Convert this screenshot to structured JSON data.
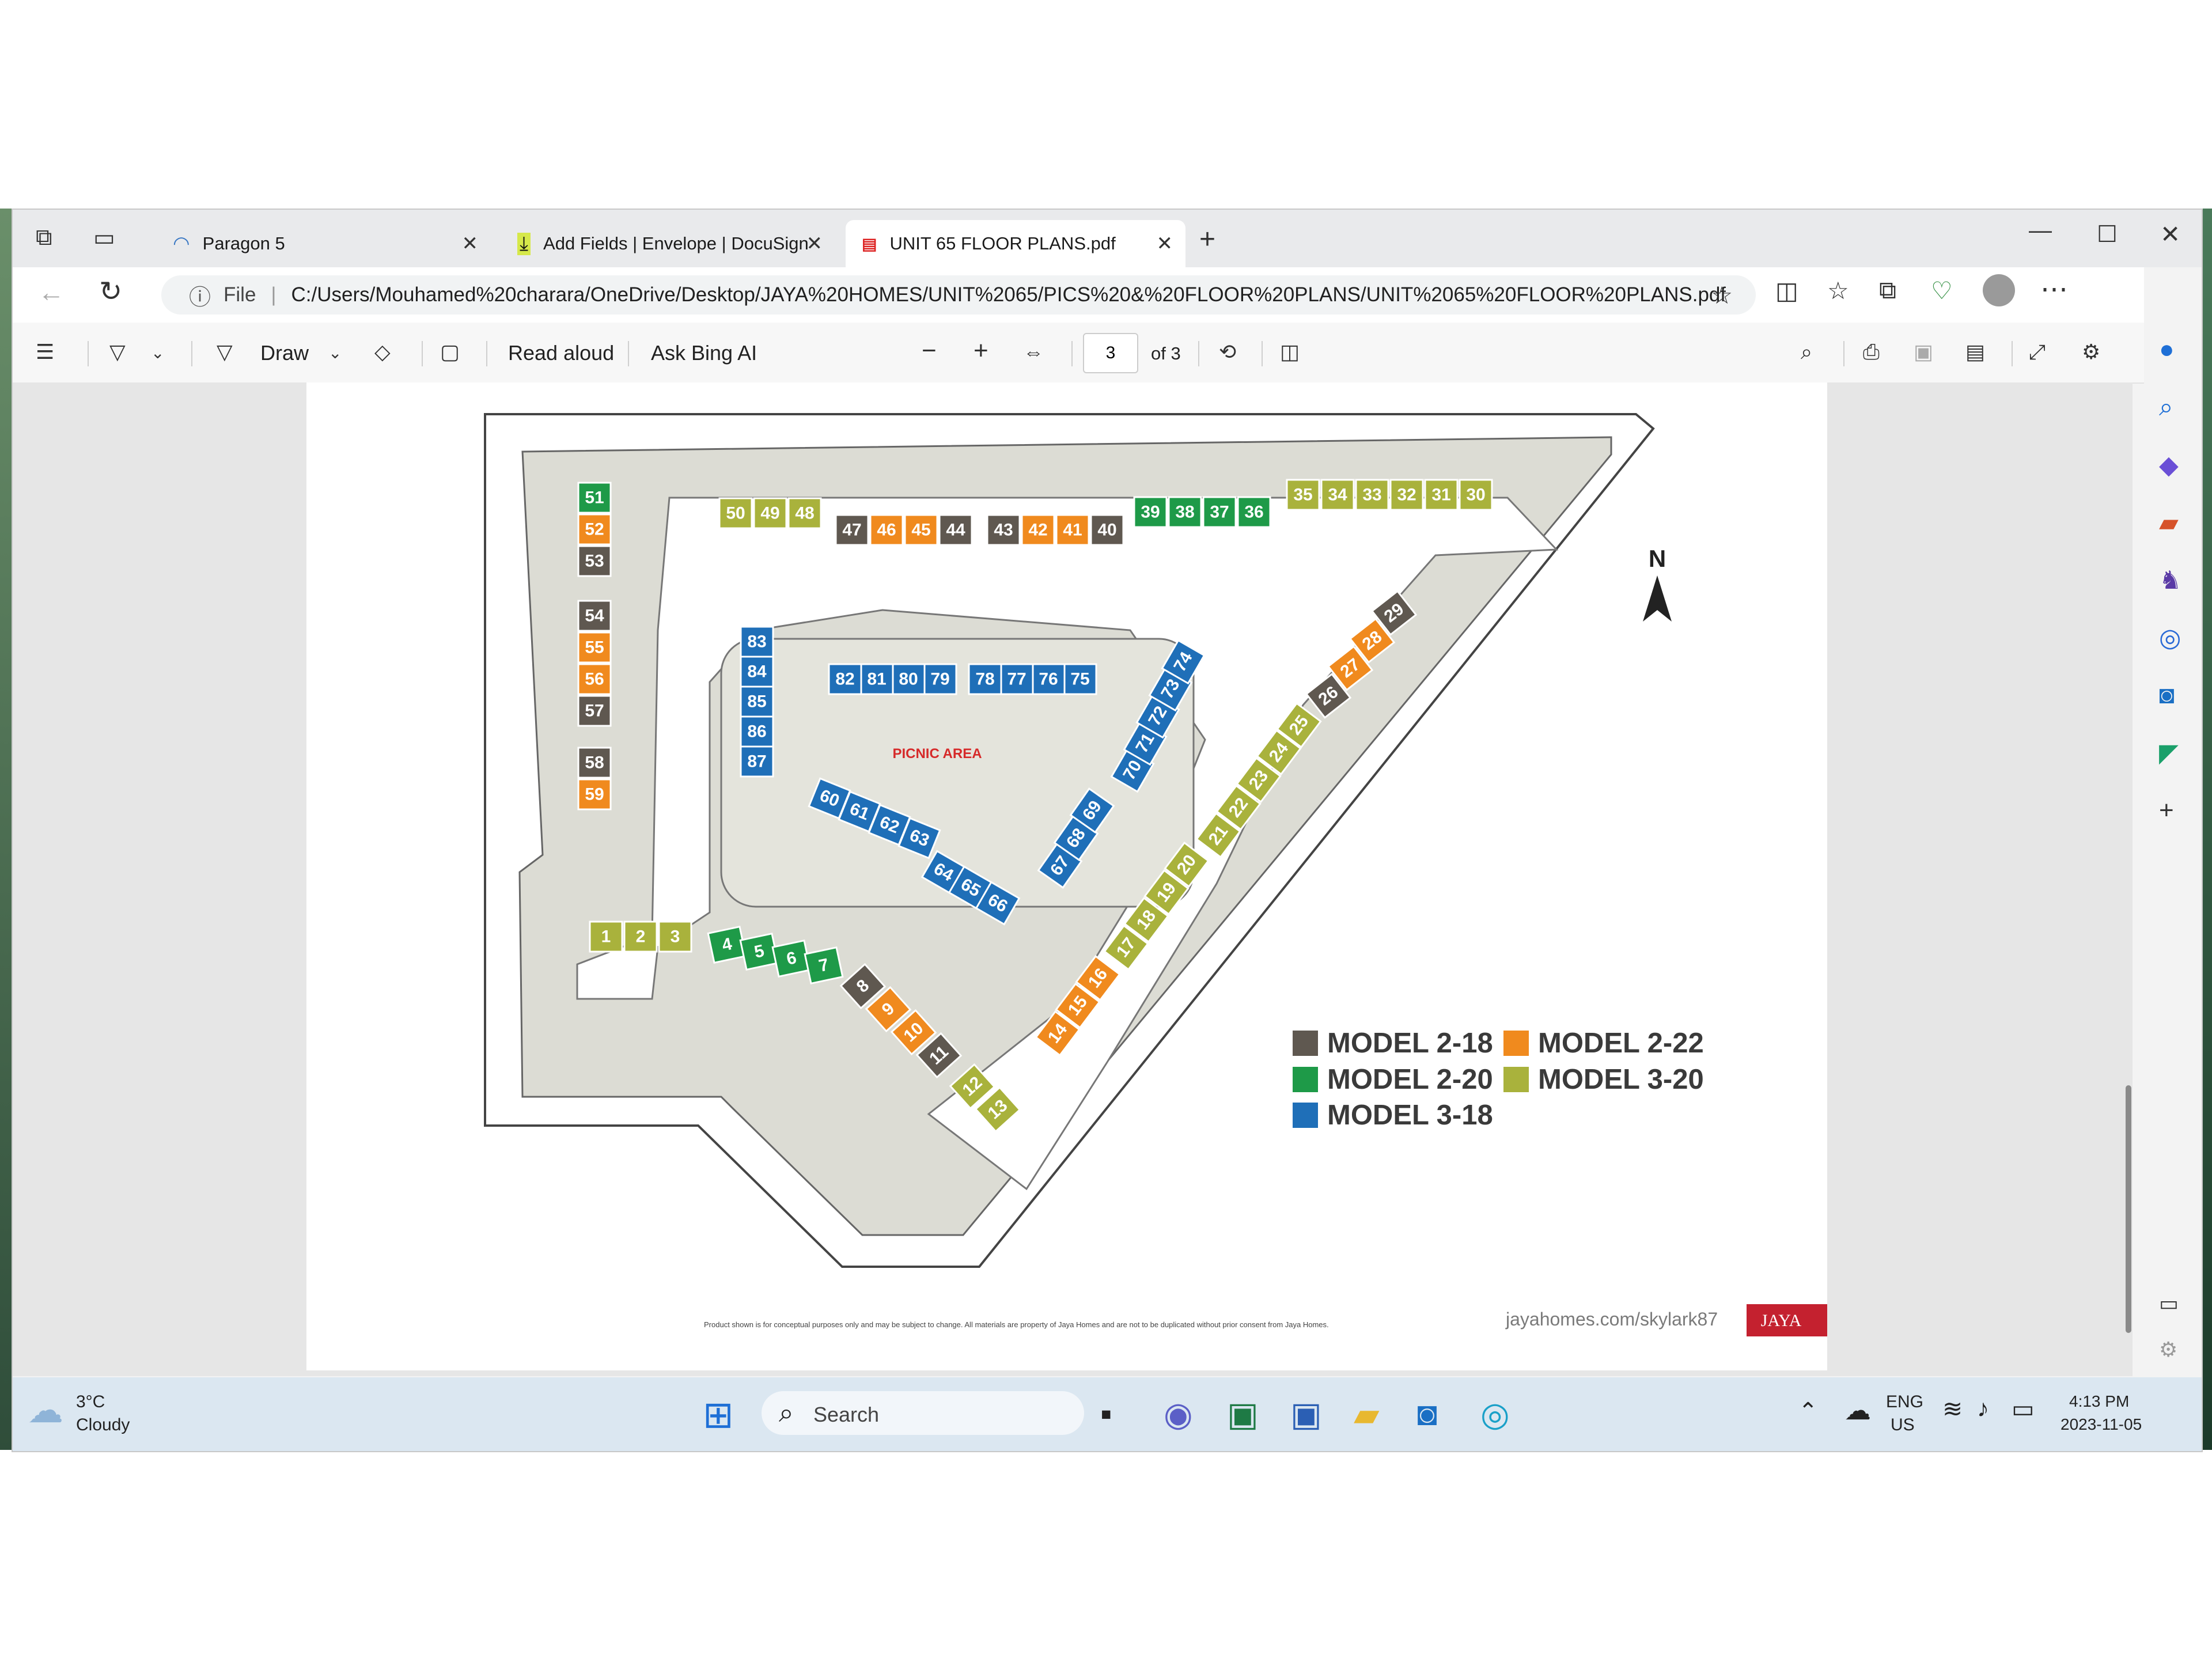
{
  "tabs": [
    {
      "label": "Paragon 5",
      "icon": "paragon-icon"
    },
    {
      "label": "Add Fields | Envelope | DocuSign",
      "icon": "download-icon"
    },
    {
      "label": "UNIT 65 FLOOR PLANS.pdf",
      "icon": "pdf-icon"
    }
  ],
  "address": {
    "scheme": "File",
    "url": "C:/Users/Mouhamed%20charara/OneDrive/Desktop/JAYA%20HOMES/UNIT%2065/PICS%20&%20FLOOR%20PLANS/UNIT%2065%20FLOOR%20PLANS.pdf"
  },
  "pdf_toolbar": {
    "draw": "Draw",
    "read_aloud": "Read aloud",
    "ask_bing": "Ask Bing AI",
    "page_current": "3",
    "page_total": "of 3"
  },
  "plan": {
    "north": "N",
    "picnic": "PICNIC AREA",
    "disclaimer": "Product shown is for conceptual purposes only and may be subject to change. All materials are property of Jaya Homes and are not to be duplicated without prior consent from Jaya Homes.",
    "url": "jayahomes.com/skylark87",
    "brand": "JAYA",
    "legend": [
      {
        "label": "MODEL 2-18",
        "color": "#5f5850"
      },
      {
        "label": "MODEL 2-22",
        "color": "#f08a1e"
      },
      {
        "label": "MODEL 2-20",
        "color": "#1e9a48"
      },
      {
        "label": "MODEL 3-20",
        "color": "#a9b23c"
      },
      {
        "label": "MODEL 3-18",
        "color": "#1f6fb8"
      }
    ],
    "colors": {
      "m218": "#5f5850",
      "m222": "#f08a1e",
      "m220": "#1e9a48",
      "m320": "#a9b23c",
      "m318": "#1f6fb8"
    },
    "units": {
      "m218": [
        "8",
        "11",
        "26",
        "29",
        "40",
        "43",
        "44",
        "47",
        "53",
        "54",
        "57",
        "58"
      ],
      "m222": [
        "9",
        "10",
        "14",
        "15",
        "16",
        "27",
        "28",
        "41",
        "42",
        "45",
        "46",
        "52",
        "55",
        "56",
        "59"
      ],
      "m220": [
        "4",
        "5",
        "6",
        "7",
        "36",
        "37",
        "38",
        "39",
        "51"
      ],
      "m320": [
        "1",
        "2",
        "3",
        "12",
        "13",
        "17",
        "18",
        "19",
        "20",
        "21",
        "22",
        "23",
        "24",
        "25",
        "30",
        "31",
        "32",
        "33",
        "34",
        "35",
        "48",
        "49",
        "50"
      ],
      "m318": [
        "60",
        "61",
        "62",
        "63",
        "64",
        "65",
        "66",
        "67",
        "68",
        "69",
        "70",
        "71",
        "72",
        "73",
        "74",
        "75",
        "76",
        "77",
        "78",
        "79",
        "80",
        "81",
        "82",
        "83",
        "84",
        "85",
        "86",
        "87"
      ]
    }
  },
  "weather": {
    "temp": "3°C",
    "cond": "Cloudy"
  },
  "taskbar": {
    "search": "Search",
    "lang1": "ENG",
    "lang2": "US",
    "time": "4:13 PM",
    "date": "2023-11-05"
  }
}
